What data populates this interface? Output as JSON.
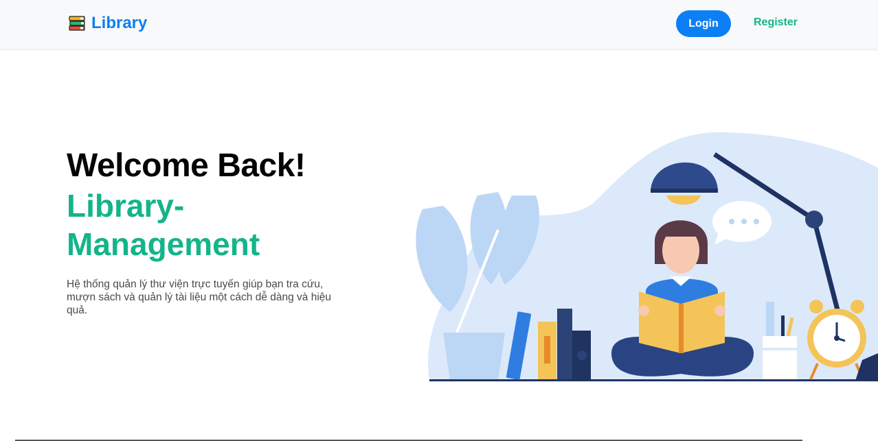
{
  "navbar": {
    "brand_label": "Library",
    "login_label": "Login",
    "register_label": "Register"
  },
  "hero": {
    "title": "Welcome Back!",
    "subtitle": "Library-Management",
    "description": "Hệ thống quản lý thư viện trực tuyến giúp bạn tra cứu, mượn sách và quản lý tài liệu một cách dễ dàng và hiệu quả."
  },
  "icons": {
    "brand": "books-stack-icon"
  },
  "colors": {
    "primary": "#0d7ff5",
    "accent": "#14b48a",
    "navbar_bg": "#f8f9fa"
  }
}
